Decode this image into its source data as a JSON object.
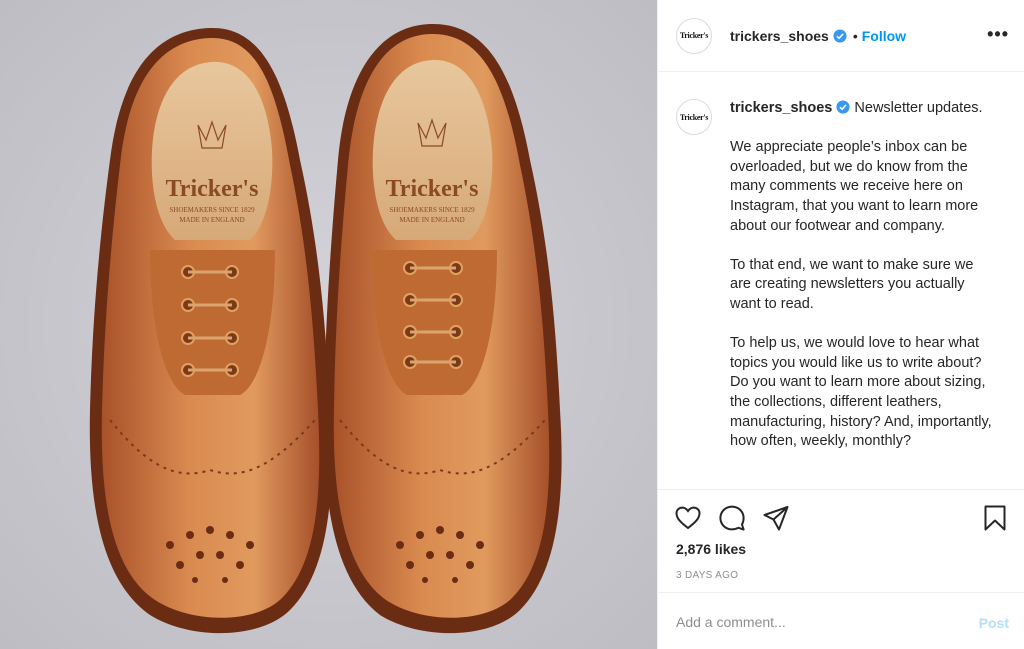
{
  "post": {
    "image_alt": "Pair of tan brogue shoes with Tricker's insoles",
    "insole_logo": "Tricker's",
    "insole_line1": "SHOEMAKERS SINCE 1829",
    "insole_line2": "MADE IN ENGLAND"
  },
  "header": {
    "avatar_text": "Tricker's",
    "username": "trickers_shoes",
    "separator": "•",
    "follow_label": "Follow",
    "more_label": "•••"
  },
  "caption": {
    "username": "trickers_shoes",
    "first_line": " Newsletter updates.",
    "paragraphs": [
      "We appreciate people’s inbox can be overloaded, but we do know from the many comments we receive here on Instagram, that you want to learn more about our footwear and company.",
      "To that end, we want to make sure we are creating newsletters you actually want to read.",
      "To help us, we would love to hear what topics you would like us to write about? Do you want to learn more about sizing, the collections, different leathers, manufacturing, history? And, importantly, how often, weekly, monthly?"
    ]
  },
  "actions": {
    "icons": [
      "heart-icon",
      "comment-icon",
      "share-icon",
      "bookmark-icon"
    ]
  },
  "likes": "2,876 likes",
  "date": "3 DAYS AGO",
  "comment": {
    "placeholder": "Add a comment...",
    "post_label": "Post"
  },
  "colors": {
    "link": "#0095f6",
    "post_disabled": "#b2dffc",
    "verified": "#3897f0",
    "leather": "#c8733a",
    "background": "#c9c9cf"
  }
}
